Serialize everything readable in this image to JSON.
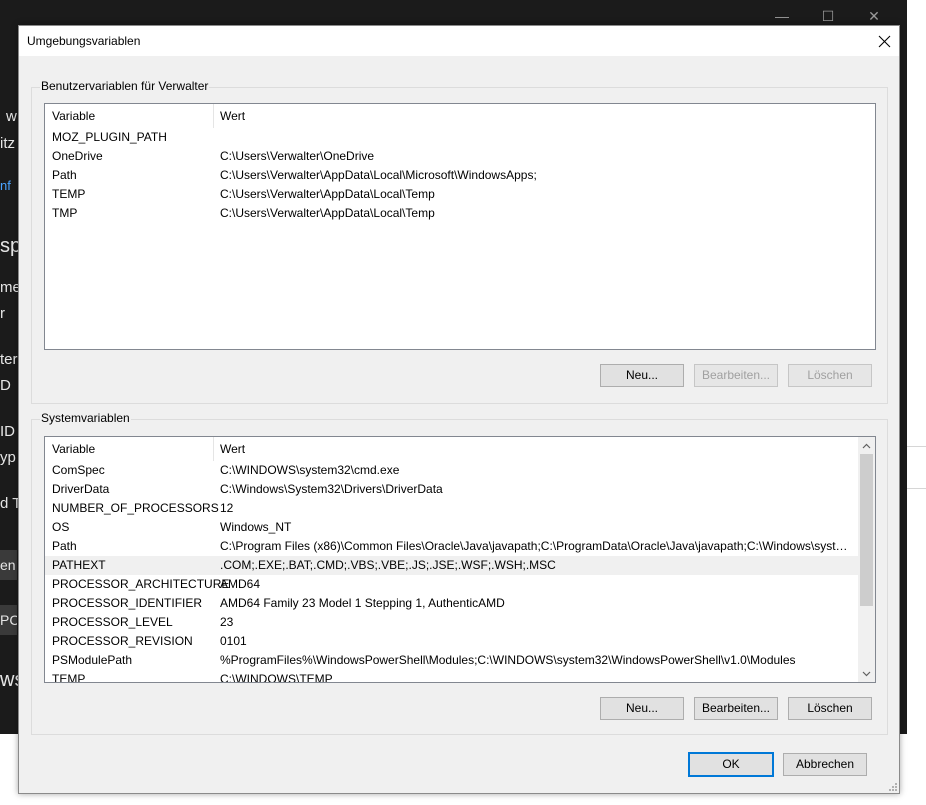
{
  "background_window": {
    "controls": {
      "minimize": "—",
      "maximize": "☐",
      "close": "✕"
    },
    "fragments": [
      "w",
      "itz",
      "nf",
      "sp",
      "me",
      "r",
      "ter",
      "D",
      "ID",
      "yp",
      "d To",
      "en",
      "PC",
      "ws"
    ]
  },
  "dialog": {
    "title": "Umgebungsvariablen",
    "user_vars": {
      "label": "Benutzervariablen für Verwalter",
      "columns": [
        "Variable",
        "Wert"
      ],
      "rows": [
        {
          "name": "MOZ_PLUGIN_PATH",
          "value": ""
        },
        {
          "name": "OneDrive",
          "value": "C:\\Users\\Verwalter\\OneDrive"
        },
        {
          "name": "Path",
          "value": "C:\\Users\\Verwalter\\AppData\\Local\\Microsoft\\WindowsApps;"
        },
        {
          "name": "TEMP",
          "value": "C:\\Users\\Verwalter\\AppData\\Local\\Temp"
        },
        {
          "name": "TMP",
          "value": "C:\\Users\\Verwalter\\AppData\\Local\\Temp"
        }
      ],
      "buttons": {
        "new": "Neu...",
        "edit": "Bearbeiten...",
        "delete": "Löschen"
      }
    },
    "system_vars": {
      "label": "Systemvariablen",
      "columns": [
        "Variable",
        "Wert"
      ],
      "rows": [
        {
          "name": "ComSpec",
          "value": "C:\\WINDOWS\\system32\\cmd.exe"
        },
        {
          "name": "DriverData",
          "value": "C:\\Windows\\System32\\Drivers\\DriverData"
        },
        {
          "name": "NUMBER_OF_PROCESSORS",
          "value": "12"
        },
        {
          "name": "OS",
          "value": "Windows_NT"
        },
        {
          "name": "Path",
          "value": "C:\\Program Files (x86)\\Common Files\\Oracle\\Java\\javapath;C:\\ProgramData\\Oracle\\Java\\javapath;C:\\Windows\\syste..."
        },
        {
          "name": "PATHEXT",
          "value": ".COM;.EXE;.BAT;.CMD;.VBS;.VBE;.JS;.JSE;.WSF;.WSH;.MSC"
        },
        {
          "name": "PROCESSOR_ARCHITECTURE",
          "value": "AMD64"
        },
        {
          "name": "PROCESSOR_IDENTIFIER",
          "value": "AMD64 Family 23 Model 1 Stepping 1, AuthenticAMD"
        },
        {
          "name": "PROCESSOR_LEVEL",
          "value": "23"
        },
        {
          "name": "PROCESSOR_REVISION",
          "value": "0101"
        },
        {
          "name": "PSModulePath",
          "value": "%ProgramFiles%\\WindowsPowerShell\\Modules;C:\\WINDOWS\\system32\\WindowsPowerShell\\v1.0\\Modules"
        },
        {
          "name": "TEMP",
          "value": "C:\\WINDOWS\\TEMP"
        }
      ],
      "selected_row": "PATHEXT",
      "buttons": {
        "new": "Neu...",
        "edit": "Bearbeiten...",
        "delete": "Löschen"
      }
    },
    "buttons": {
      "ok": "OK",
      "cancel": "Abbrechen"
    }
  },
  "colors": {
    "accent": "#0078d7",
    "selection": "#f0f0f0",
    "dialog_bg": "#f0f0f0"
  }
}
